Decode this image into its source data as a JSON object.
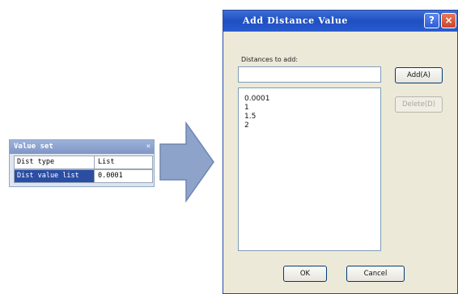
{
  "property_panel": {
    "title": "Value set",
    "close_glyph": "×",
    "rows": [
      {
        "key": "Dist type",
        "value": "List"
      },
      {
        "key": "Dist value list",
        "value": "0.0001"
      }
    ]
  },
  "arrow": {
    "icon": "right-arrow-icon",
    "color": "#8ea3c9"
  },
  "dialog": {
    "title": "Add Distance Value",
    "help_glyph": "?",
    "close_glyph": "×",
    "distances_label": "Distances to add:",
    "input_value": "",
    "add_label": "Add(A)",
    "delete_label": "Delete(D)",
    "values": [
      "0.0001",
      "1",
      "1.5",
      "2"
    ],
    "ok_label": "OK",
    "cancel_label": "Cancel"
  },
  "colors": {
    "title_bar": "#1f4fc1",
    "dialog_bg": "#ece9d8",
    "panel_title": "#8ba0cc",
    "selected_key": "#2b4ea3"
  }
}
